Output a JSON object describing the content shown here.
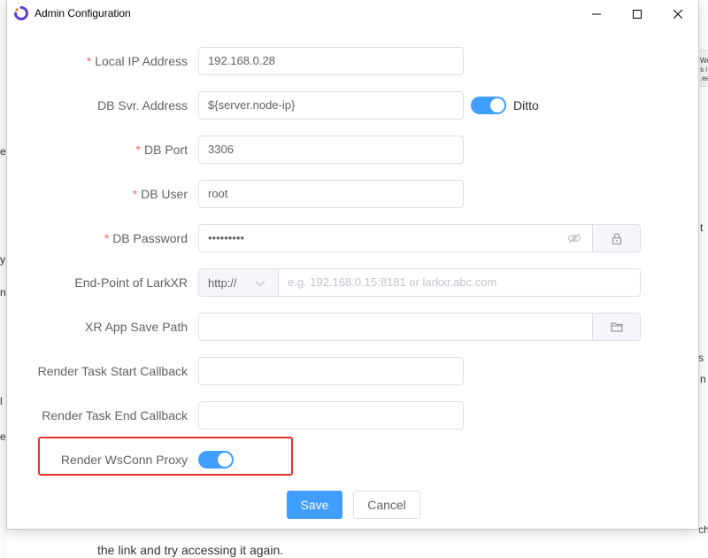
{
  "window": {
    "title": "Admin Configuration",
    "controls": [
      "minimize",
      "maximize",
      "close"
    ]
  },
  "form": {
    "local_ip": {
      "label": "Local IP Address",
      "required": "*",
      "value": "192.168.0.28"
    },
    "db_server": {
      "label": "DB Svr. Address",
      "value": "${server.node-ip}",
      "toggle_label": "Ditto",
      "toggle_on": true
    },
    "db_port": {
      "label": "DB Port",
      "required": "*",
      "value": "3306"
    },
    "db_user": {
      "label": "DB User",
      "required": "*",
      "value": "root"
    },
    "db_password": {
      "label": "DB Password",
      "required": "*",
      "value": "•••••••••",
      "visibility_icon": "eye-off-icon",
      "append_icon": "lock-icon"
    },
    "endpoint": {
      "label": "End-Point of LarkXR",
      "protocol": "http://",
      "placeholder": "e.g. 192.168.0.15:8181 or larkxr.abc.com"
    },
    "xr_app_path": {
      "label": "XR App Save Path",
      "value": "",
      "append_icon": "folder-icon"
    },
    "render_start_cb": {
      "label": "Render Task Start Callback",
      "value": ""
    },
    "render_end_cb": {
      "label": "Render Task End Callback",
      "value": ""
    },
    "render_wsconn_proxy": {
      "label": "Render WsConn Proxy",
      "toggle_on": true
    }
  },
  "buttons": {
    "save": "Save",
    "cancel": "Cancel"
  },
  "background": {
    "bottom_text": "the link and try accessing it again.",
    "left_fragments": [
      "er",
      "y",
      "n",
      "l",
      "ep"
    ],
    "right_fragments": [
      "We",
      "s i",
      ".ea",
      "t",
      "s",
      "n",
      "ch"
    ]
  },
  "colors": {
    "primary": "#409eff",
    "required": "#f56c6c",
    "highlight": "#e5332a"
  }
}
